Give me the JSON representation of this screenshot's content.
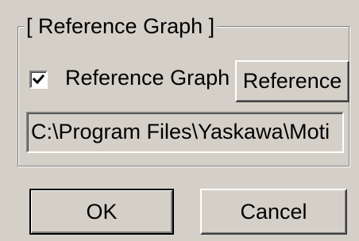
{
  "group": {
    "legend": "[ Reference Graph ]"
  },
  "reference_checkbox": {
    "label": "Reference Graph",
    "checked": true
  },
  "reference_button": {
    "label": "Reference"
  },
  "path_field": {
    "value": "C:\\Program Files\\Yaskawa\\Moti"
  },
  "dialog_buttons": {
    "ok_label": "OK",
    "cancel_label": "Cancel"
  }
}
